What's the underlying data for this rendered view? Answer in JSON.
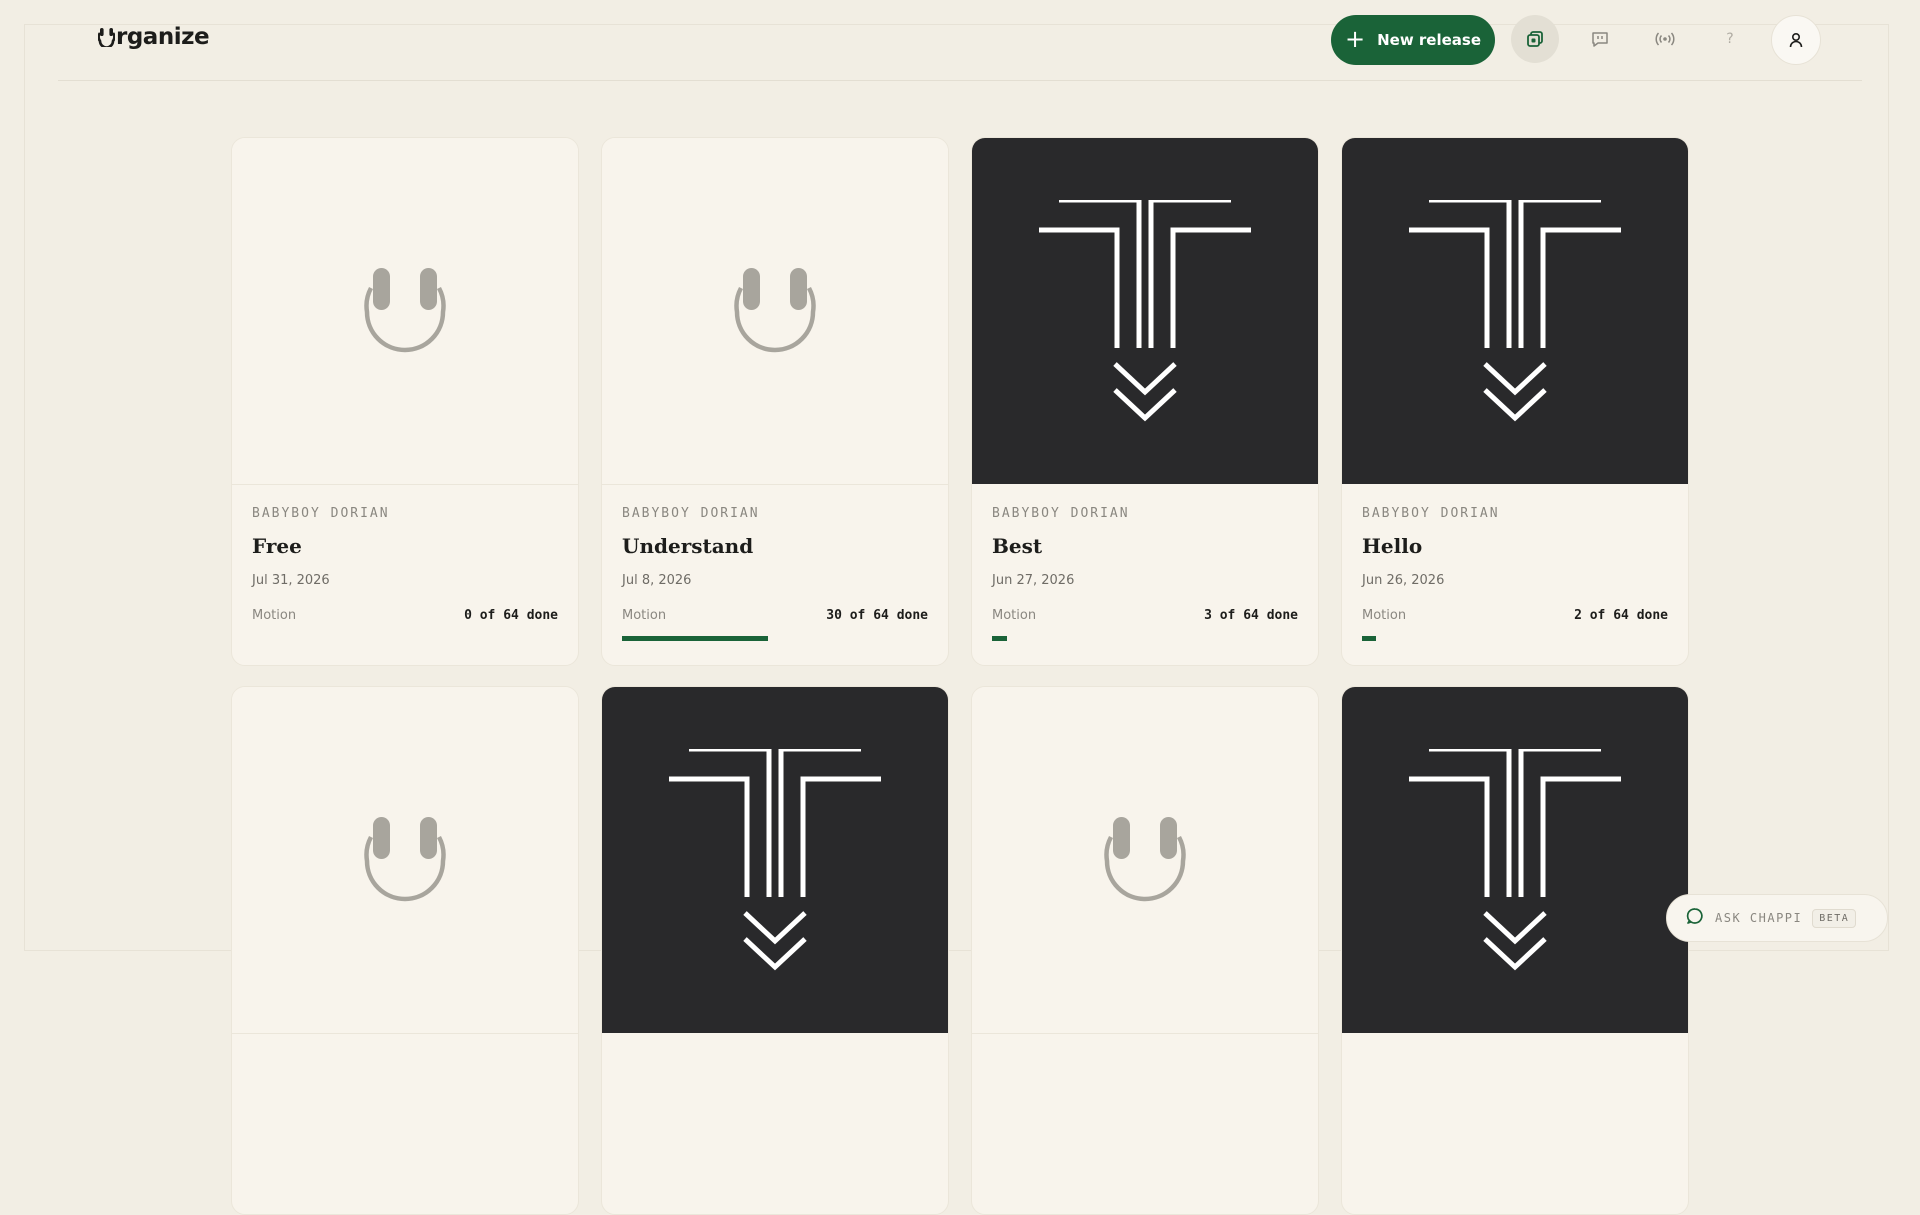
{
  "app": {
    "logo_text": "rganize",
    "logo_icon": "headphones-u-icon"
  },
  "header": {
    "new_release_label": "New release",
    "icons": [
      "releases-icon",
      "feedback-icon",
      "broadcast-icon",
      "help-icon",
      "profile-icon"
    ],
    "help_glyph": "?"
  },
  "colors": {
    "accent": "#1a6338",
    "background": "#f2eee4",
    "card": "#f8f4ec",
    "dark_art": "#29292b"
  },
  "releases": [
    {
      "artist": "BABYBOY DORIAN",
      "title": "Free",
      "date": "Jul 31, 2026",
      "category": "Motion",
      "done_text": "0 of 64 done",
      "done": 0,
      "total": 64,
      "art": "headphones-placeholder"
    },
    {
      "artist": "BABYBOY DORIAN",
      "title": "Understand",
      "date": "Jul 8, 2026",
      "category": "Motion",
      "done_text": "30 of 64 done",
      "done": 30,
      "total": 64,
      "art": "headphones-placeholder"
    },
    {
      "artist": "BABYBOY DORIAN",
      "title": "Best",
      "date": "Jun 27, 2026",
      "category": "Motion",
      "done_text": "3 of 64 done",
      "done": 3,
      "total": 64,
      "art": "t-chevron-artwork"
    },
    {
      "artist": "BABYBOY DORIAN",
      "title": "Hello",
      "date": "Jun 26, 2026",
      "category": "Motion",
      "done_text": "2 of 64 done",
      "done": 2,
      "total": 64,
      "art": "t-chevron-artwork"
    },
    {
      "art": "headphones-placeholder"
    },
    {
      "art": "t-chevron-artwork"
    },
    {
      "art": "headphones-placeholder"
    },
    {
      "art": "t-chevron-artwork"
    }
  ],
  "chat": {
    "label": "ASK CHAPPI",
    "badge": "BETA"
  }
}
